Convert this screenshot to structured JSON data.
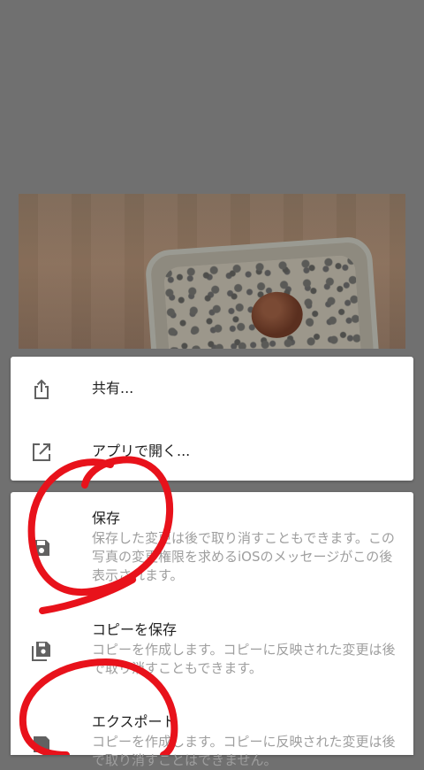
{
  "menu": {
    "share_label": "共有...",
    "open_in_app_label": "アプリで開く...",
    "save": {
      "label": "保存",
      "description": "保存した変更は後で取り消すこともできます。この写真の変更権限を求めるiOSのメッセージがこの後表示されます。"
    },
    "save_copy": {
      "label": "コピーを保存",
      "description": "コピーを作成します。コピーに反映された変更は後で取り消すこともできます。"
    },
    "export": {
      "label": "エクスポート",
      "description": "コピーを作成します。コピーに反映された変更は後で取り消すことはできません。"
    }
  },
  "icons": {
    "share": "share-icon",
    "open_in_app": "open-external-icon",
    "save": "save-icon",
    "save_copy": "save-copy-icon",
    "export": "export-icon"
  },
  "colors": {
    "overlay": "#707070",
    "sheet": "#ffffff",
    "title_text": "#212121",
    "desc_text": "#9e9e9e",
    "icon": "#616161",
    "annotation_red": "#e8121b"
  }
}
